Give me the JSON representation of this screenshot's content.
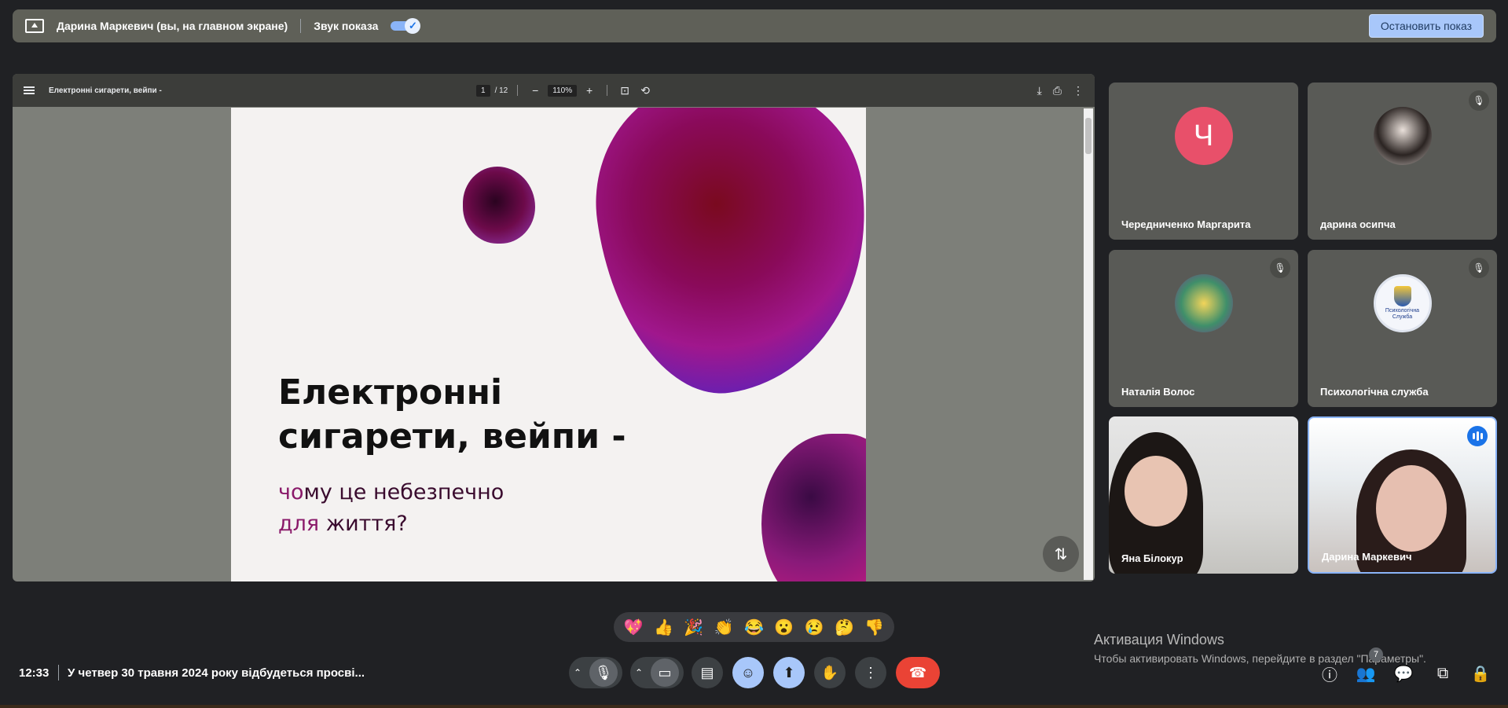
{
  "present_bar": {
    "presenter_text": "Дарина Маркевич (вы, на главном экране)",
    "sound_label": "Звук показа",
    "sound_enabled": true,
    "stop_button": "Остановить показ"
  },
  "pdf_viewer": {
    "title": "Електронні сигарети, вейпи -",
    "page_current": "1",
    "page_total": "/ 12",
    "zoom": "110%",
    "minus": "−",
    "plus": "+",
    "icons": [
      "menu-icon",
      "fit-page-icon",
      "rotate-icon",
      "download-icon",
      "print-icon",
      "more-vert-icon"
    ]
  },
  "slide": {
    "title_line1": "Електронні",
    "title_line2": "сигарети, вейпи -",
    "sub_line1_accent": "чо",
    "sub_line1_rest": "му це небезпечно",
    "sub_line2_accent": "для ",
    "sub_line2_rest": "життя?"
  },
  "participants": [
    {
      "name": "Чередниченко Маргарита",
      "avatar_letter": "Ч",
      "muted": false
    },
    {
      "name": "дарина осипча",
      "muted": true
    },
    {
      "name": "Наталія Волос",
      "muted": true
    },
    {
      "name": "Психологічна служба",
      "muted": true,
      "logo_text": "Психологічна Служба"
    },
    {
      "name": "Яна Білокур",
      "video": true
    },
    {
      "name": "Дарина Маркевич",
      "video": true,
      "speaking": true
    }
  ],
  "reactions": [
    "💖",
    "👍",
    "🎉",
    "👏",
    "😂",
    "😮",
    "😢",
    "🤔",
    "👎"
  ],
  "watermark": {
    "title": "Активация Windows",
    "text": "Чтобы активировать Windows, перейдите в раздел \"Параметры\"."
  },
  "bottom_bar": {
    "time": "12:33",
    "meeting_title": "У четвер 30 травня 2024 року відбудеться просві...",
    "participants_count": "7"
  },
  "colors": {
    "background": "#202124",
    "present_bar": "#5f6058",
    "accent_blue": "#a8c7fa",
    "end_call": "#ea4335"
  }
}
